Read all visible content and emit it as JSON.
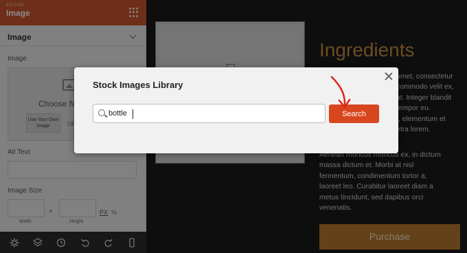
{
  "panel": {
    "editing_label": "EDITING",
    "title": "Image",
    "section_title": "Image",
    "image_label": "Image",
    "choose_text": "Choose Ne",
    "own_image_button": "Use Your Own Image",
    "or_text": "OR",
    "alt_text_label": "Alt Text",
    "image_size_label": "Image Size",
    "width_caption": "Width",
    "height_caption": "Height",
    "size_separator": "×",
    "unit_px": "PX",
    "unit_pct": "%"
  },
  "toolbar": {
    "icons": [
      "gear-icon",
      "layers-icon",
      "history-icon",
      "undo-icon",
      "redo-icon",
      "mobile-icon"
    ]
  },
  "preview": {
    "heading": "Ingredients",
    "para1": "amet, consectetur\ncommodo velit ex,\nat. Integer blandit\ntempor eu.\nt, elementum et\netra lorem.",
    "para2": "Aenean rhoncus rhoncus ex, in dictum\nmassa dictum et. Morbi at nisl\nfermentum, condimentum tortor a,\nlaoreet leo. Curabitur laoreet diam a\nmetus tincidunt, sed dapibus orci\nvenenatis.",
    "purchase_button": "Purchase"
  },
  "modal": {
    "title": "Stock Images Library",
    "search_value": "bottle",
    "search_button": "Search"
  },
  "colors": {
    "accent": "#c9542f",
    "search_button": "#d8461e",
    "gold": "#c58a41",
    "annotation_arrow": "#e0281b"
  }
}
